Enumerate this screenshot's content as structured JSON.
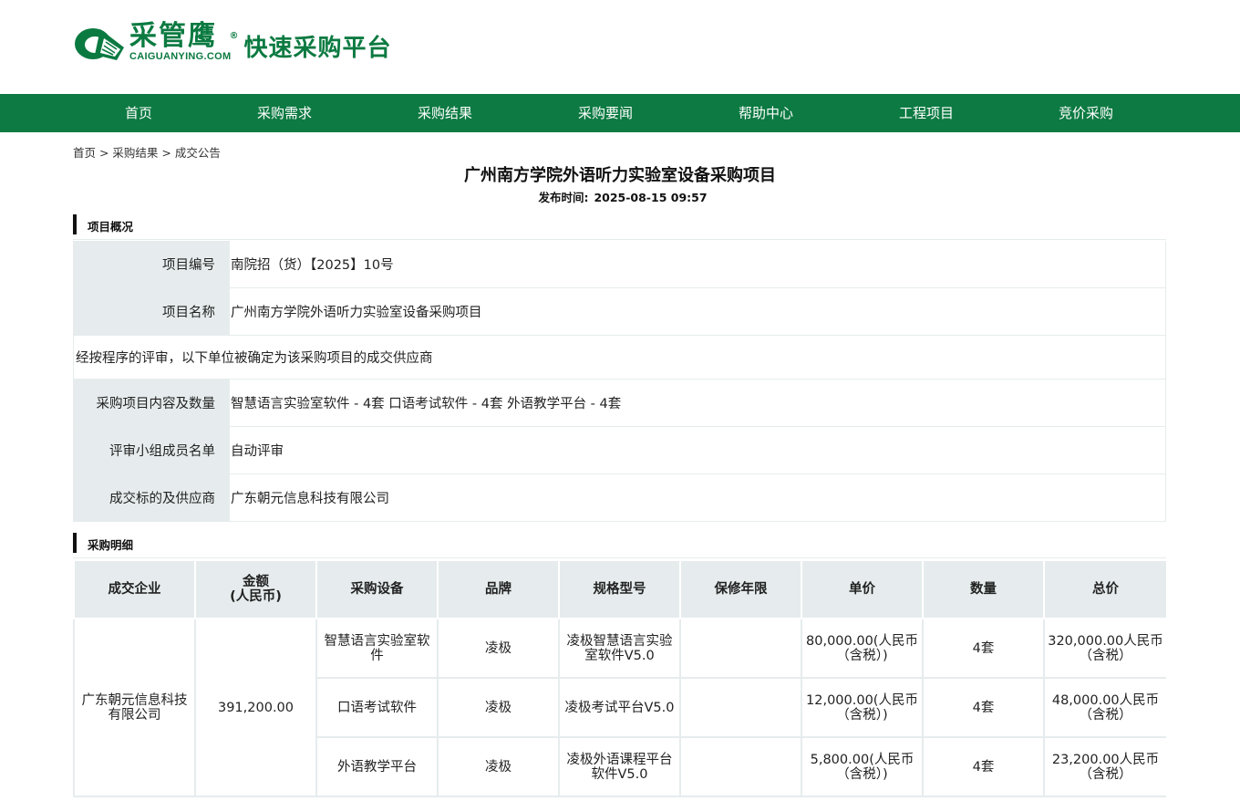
{
  "logo": {
    "brand": "采管鹰",
    "registered": "®",
    "domain": "CAIGUANYING.COM",
    "slogan": "快速采购平台"
  },
  "nav": {
    "items": [
      "首页",
      "采购需求",
      "采购结果",
      "采购要闻",
      "帮助中心",
      "工程项目",
      "竞价采购"
    ]
  },
  "breadcrumb": "首页 > 采购结果 > 成交公告",
  "page_title": "广州南方学院外语听力实验室设备采购项目",
  "publish": {
    "label": "发布时间:",
    "value": "2025-08-15 09:57"
  },
  "overview": {
    "heading": "项目概况",
    "project_no_label": "项目编号",
    "project_no": "南院招（货）【2025】10号",
    "project_name_label": "项目名称",
    "project_name": "广州南方学院外语听力实验室设备采购项目",
    "statement": "经按程序的评审，以下单位被确定为该采购项目的成交供应商",
    "content_label": "采购项目内容及数量",
    "content": "智慧语言实验室软件 - 4套 口语考试软件 - 4套 外语教学平台 - 4套",
    "panel_label": "评审小组成员名单",
    "panel": "自动评审",
    "supplier_label": "成交标的及供应商",
    "supplier": "广东朝元信息科技有限公司"
  },
  "detail": {
    "heading": "采购明细",
    "columns": {
      "company": "成交企业",
      "amount_1": "金额",
      "amount_2": "(人民币)",
      "device": "采购设备",
      "brand": "品牌",
      "model": "规格型号",
      "warranty": "保修年限",
      "unit_price": "单价",
      "quantity": "数量",
      "total": "总价"
    },
    "company": "广东朝元信息科技有限公司",
    "amount": "391,200.00",
    "rows": [
      {
        "device": "智慧语言实验室软件",
        "brand": "凌极",
        "model": "凌极智慧语言实验室软件V5.0",
        "warranty": "",
        "unit_price": "80,000.00(人民币（含税）)",
        "quantity": "4套",
        "total": "320,000.00人民币（含税）"
      },
      {
        "device": "口语考试软件",
        "brand": "凌极",
        "model": "凌极考试平台V5.0",
        "warranty": "",
        "unit_price": "12,000.00(人民币（含税）)",
        "quantity": "4套",
        "total": "48,000.00人民币（含税）"
      },
      {
        "device": "外语教学平台",
        "brand": "凌极",
        "model": "凌极外语课程平台软件V5.0",
        "warranty": "",
        "unit_price": "5,800.00(人民币（含税）)",
        "quantity": "4套",
        "total": "23,200.00人民币（含税）"
      }
    ]
  },
  "colors": {
    "brand_green": "#0c7a42",
    "label_bg": "#e6eced"
  }
}
